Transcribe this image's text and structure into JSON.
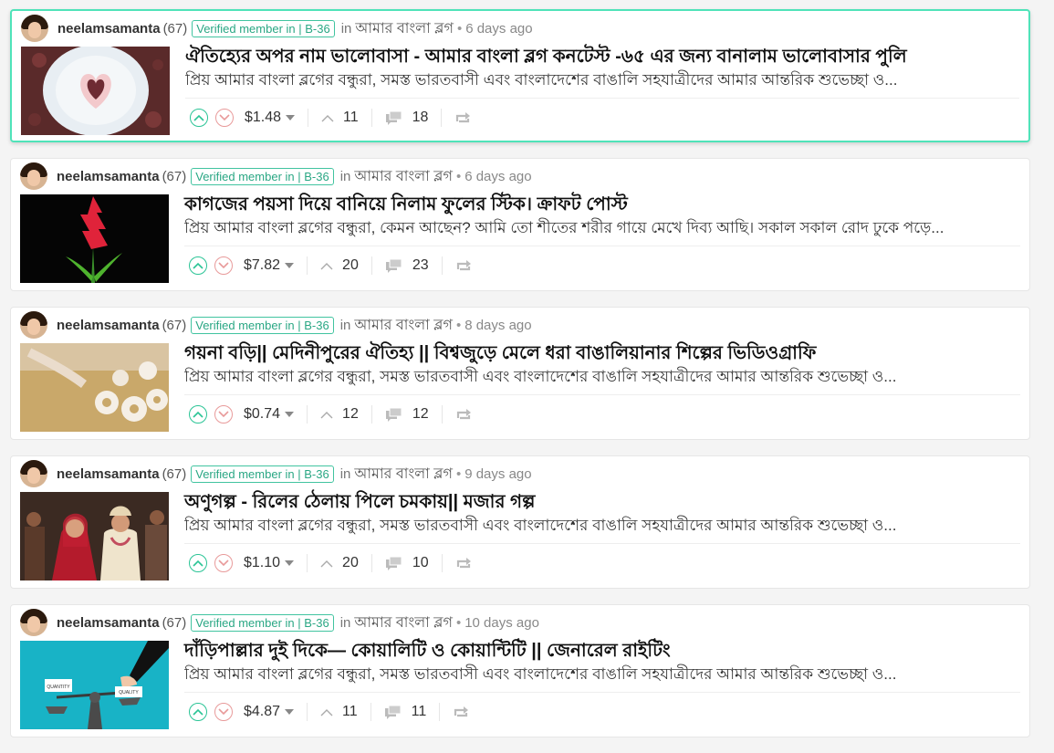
{
  "posts": [
    {
      "author": "neelamsamanta",
      "rep": "(67)",
      "badge": "Verified member in | B-36",
      "in_label": "in",
      "community": "আমার বাংলা ব্লগ",
      "dot": "•",
      "age": "6 days ago",
      "title": "ঐতিহ্যের অপর নাম ভালোবাসা - আমার বাংলা ব্লগ কনটেস্ট -৬৫ এর জন্য বানালাম ভালোবাসার পুলি",
      "desc": "প্রিয় আমার বাংলা ব্লগের বন্ধুরা, সমস্ত ভারতবাসী এবং বাংলাদেশের বাঙালি সহযাত্রীদের আমার আন্তরিক শুভেচ্ছা ও...",
      "payout": "$1.48",
      "votes": "11",
      "comments": "18",
      "active": true,
      "thumb": "plate"
    },
    {
      "author": "neelamsamanta",
      "rep": "(67)",
      "badge": "Verified member in | B-36",
      "in_label": "in",
      "community": "আমার বাংলা ব্লগ",
      "dot": "•",
      "age": "6 days ago",
      "title": "কাগজের পয়সা দিয়ে বানিয়ে নিলাম ফুলের স্টিক। ক্রাফট পোস্ট",
      "desc": "প্রিয় আমার বাংলা ব্লগের বন্ধুরা, কেমন আছেন? আমি তো শীতের শরীর গায়ে মেখে দিব্য আছি। সকাল সকাল রোদ ঢুকে পড়ে...",
      "payout": "$7.82",
      "votes": "20",
      "comments": "23",
      "active": false,
      "thumb": "flower"
    },
    {
      "author": "neelamsamanta",
      "rep": "(67)",
      "badge": "Verified member in | B-36",
      "in_label": "in",
      "community": "আমার বাংলা ব্লগ",
      "dot": "•",
      "age": "8 days ago",
      "title": "গয়না বড়ি|| মেদিনীপুরের ঐতিহ্য || বিশ্বজুড়ে মেলে ধরা বাঙালিয়ানার শিল্পের ভিডিওগ্রাফি",
      "desc": "প্রিয় আমার বাংলা ব্লগের বন্ধুরা, সমস্ত ভারতবাসী এবং বাংলাদেশের বাঙালি সহযাত্রীদের আমার আন্তরিক শুভেচ্ছা ও...",
      "payout": "$0.74",
      "votes": "12",
      "comments": "12",
      "active": false,
      "thumb": "bori"
    },
    {
      "author": "neelamsamanta",
      "rep": "(67)",
      "badge": "Verified member in | B-36",
      "in_label": "in",
      "community": "আমার বাংলা ব্লগ",
      "dot": "•",
      "age": "9 days ago",
      "title": "অণুগল্প - রিলের ঠেলায় পিলে চমকায়|| মজার গল্প",
      "desc": "প্রিয় আমার বাংলা ব্লগের বন্ধুরা, সমস্ত ভারতবাসী এবং বাংলাদেশের বাঙালি সহযাত্রীদের আমার আন্তরিক শুভেচ্ছা ও...",
      "payout": "$1.10",
      "votes": "20",
      "comments": "10",
      "active": false,
      "thumb": "wedding"
    },
    {
      "author": "neelamsamanta",
      "rep": "(67)",
      "badge": "Verified member in | B-36",
      "in_label": "in",
      "community": "আমার বাংলা ব্লগ",
      "dot": "•",
      "age": "10 days ago",
      "title": "দাঁড়িপাল্লার দুই দিকে— কোয়ালিটি ও কোয়ান্টিটি || জেনারেল রাইটিং",
      "desc": "প্রিয় আমার বাংলা ব্লগের বন্ধুরা, সমস্ত ভারতবাসী এবং বাংলাদেশের বাঙালি সহযাত্রীদের আমার আন্তরিক শুভেচ্ছা ও...",
      "payout": "$4.87",
      "votes": "11",
      "comments": "11",
      "active": false,
      "thumb": "scale",
      "thumb_labels": [
        "QUANTITY",
        "QUALITY"
      ]
    }
  ],
  "colors": {
    "upvote": "#2bc496",
    "downvote": "#e89a9a",
    "active_border": "#4fe3b9",
    "badge": "#2aa784"
  }
}
